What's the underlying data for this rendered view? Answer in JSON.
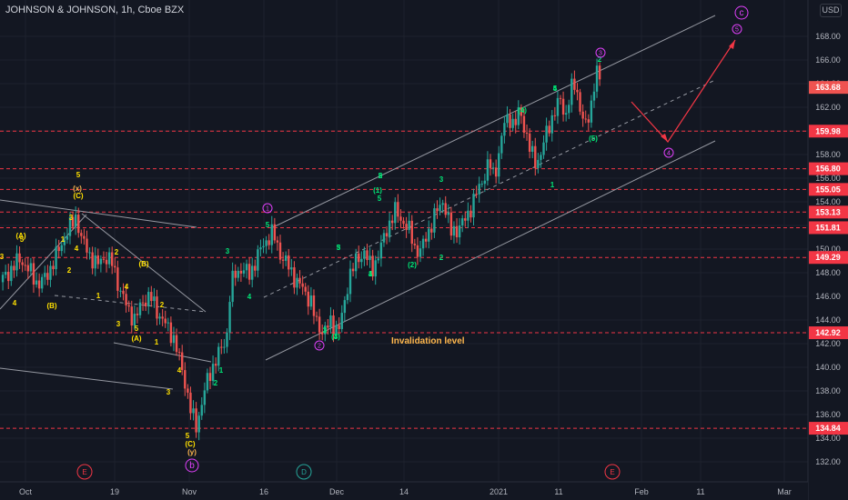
{
  "header": {
    "title": "JOHNSON & JOHNSON, 1h, Cboe BZX",
    "currency": "USD"
  },
  "chart_data": {
    "type": "candlestick",
    "title": "JOHNSON & JOHNSON, 1h, Cboe BZX",
    "ylim": [
      131,
      171
    ],
    "y_ticks": [
      "132.00",
      "134.00",
      "136.00",
      "138.00",
      "140.00",
      "142.00",
      "144.00",
      "146.00",
      "148.00",
      "150.00",
      "152.00",
      "154.00",
      "156.00",
      "158.00",
      "160.00",
      "162.00",
      "164.00",
      "166.00",
      "168.00"
    ],
    "x_ticks": [
      "Oct",
      "19",
      "Nov",
      "16",
      "Dec",
      "14",
      "2021",
      "11",
      "Feb",
      "11",
      "Mar"
    ],
    "price_path": [
      {
        "t": 0.0,
        "p": 147.2
      },
      {
        "t": 0.02,
        "p": 148.2
      },
      {
        "t": 0.04,
        "p": 149.2
      },
      {
        "t": 0.06,
        "p": 148.0
      },
      {
        "t": 0.075,
        "p": 147.0
      },
      {
        "t": 0.09,
        "p": 147.6
      },
      {
        "t": 0.11,
        "p": 149.4
      },
      {
        "t": 0.13,
        "p": 151.3
      },
      {
        "t": 0.15,
        "p": 152.8
      },
      {
        "t": 0.16,
        "p": 150.8
      },
      {
        "t": 0.175,
        "p": 149.6
      },
      {
        "t": 0.19,
        "p": 148.6
      },
      {
        "t": 0.205,
        "p": 149.4
      },
      {
        "t": 0.22,
        "p": 148.8
      },
      {
        "t": 0.235,
        "p": 146.6
      },
      {
        "t": 0.25,
        "p": 145.0
      },
      {
        "t": 0.265,
        "p": 144.0
      },
      {
        "t": 0.28,
        "p": 145.6
      },
      {
        "t": 0.295,
        "p": 146.0
      },
      {
        "t": 0.31,
        "p": 144.6
      },
      {
        "t": 0.325,
        "p": 143.6
      },
      {
        "t": 0.34,
        "p": 142.6
      },
      {
        "t": 0.355,
        "p": 140.2
      },
      {
        "t": 0.365,
        "p": 138.4
      },
      {
        "t": 0.375,
        "p": 136.2
      },
      {
        "t": 0.385,
        "p": 135.0
      },
      {
        "t": 0.395,
        "p": 136.8
      },
      {
        "t": 0.405,
        "p": 138.6
      },
      {
        "t": 0.415,
        "p": 139.8
      },
      {
        "t": 0.425,
        "p": 140.8
      },
      {
        "t": 0.435,
        "p": 141.6
      },
      {
        "t": 0.445,
        "p": 142.6
      },
      {
        "t": 0.452,
        "p": 146.6
      },
      {
        "t": 0.46,
        "p": 147.8
      },
      {
        "t": 0.475,
        "p": 148.4
      },
      {
        "t": 0.49,
        "p": 147.8
      },
      {
        "t": 0.505,
        "p": 149.4
      },
      {
        "t": 0.52,
        "p": 150.6
      },
      {
        "t": 0.535,
        "p": 151.4
      },
      {
        "t": 0.55,
        "p": 149.6
      },
      {
        "t": 0.565,
        "p": 148.6
      },
      {
        "t": 0.58,
        "p": 147.4
      },
      {
        "t": 0.595,
        "p": 146.6
      },
      {
        "t": 0.61,
        "p": 145.6
      },
      {
        "t": 0.62,
        "p": 143.8
      },
      {
        "t": 0.635,
        "p": 143.0
      },
      {
        "t": 0.65,
        "p": 143.8
      },
      {
        "t": 0.665,
        "p": 143.2
      },
      {
        "t": 0.675,
        "p": 145.0
      },
      {
        "t": 0.685,
        "p": 147.8
      },
      {
        "t": 0.7,
        "p": 149.0
      },
      {
        "t": 0.715,
        "p": 149.8
      },
      {
        "t": 0.73,
        "p": 148.2
      },
      {
        "t": 0.745,
        "p": 149.8
      },
      {
        "t": 0.76,
        "p": 151.8
      },
      {
        "t": 0.775,
        "p": 153.2
      },
      {
        "t": 0.79,
        "p": 152.4
      },
      {
        "t": 0.805,
        "p": 151.4
      },
      {
        "t": 0.815,
        "p": 150.0
      },
      {
        "t": 0.825,
        "p": 149.8
      },
      {
        "t": 0.84,
        "p": 151.4
      },
      {
        "t": 0.855,
        "p": 153.0
      },
      {
        "t": 0.87,
        "p": 154.2
      },
      {
        "t": 0.885,
        "p": 151.4
      },
      {
        "t": 0.9,
        "p": 151.8
      },
      {
        "t": 0.915,
        "p": 152.6
      },
      {
        "t": 0.93,
        "p": 154.2
      },
      {
        "t": 0.945,
        "p": 155.6
      },
      {
        "t": 0.96,
        "p": 157.4
      },
      {
        "t": 0.97,
        "p": 156.0
      },
      {
        "t": 0.98,
        "p": 158.4
      },
      {
        "t": 0.99,
        "p": 160.6
      },
      {
        "t": 1.0,
        "p": 161.2
      },
      {
        "t": 1.01,
        "p": 160.4
      },
      {
        "t": 1.02,
        "p": 161.8
      },
      {
        "t": 1.03,
        "p": 160.2
      },
      {
        "t": 1.04,
        "p": 158.4
      },
      {
        "t": 1.05,
        "p": 157.4
      },
      {
        "t": 1.06,
        "p": 157.8
      },
      {
        "t": 1.075,
        "p": 160.2
      },
      {
        "t": 1.09,
        "p": 161.8
      },
      {
        "t": 1.1,
        "p": 162.6
      },
      {
        "t": 1.11,
        "p": 161.2
      },
      {
        "t": 1.12,
        "p": 163.4
      },
      {
        "t": 1.13,
        "p": 164.0
      },
      {
        "t": 1.14,
        "p": 161.6
      },
      {
        "t": 1.15,
        "p": 160.2
      },
      {
        "t": 1.16,
        "p": 162.2
      },
      {
        "t": 1.17,
        "p": 165.2
      },
      {
        "t": 1.18,
        "p": 163.7
      }
    ],
    "horizontal_levels": [
      {
        "value": 159.98,
        "label": "159.98"
      },
      {
        "value": 156.8,
        "label": "156.80"
      },
      {
        "value": 155.05,
        "label": "155.05"
      },
      {
        "value": 153.13,
        "label": "153.13"
      },
      {
        "value": 151.81,
        "label": "151.81"
      },
      {
        "value": 149.29,
        "label": "149.29"
      },
      {
        "value": 142.92,
        "label": "142.92"
      },
      {
        "value": 134.84,
        "label": "134.84"
      }
    ],
    "last_price": {
      "value": 163.68,
      "label": "163.68"
    },
    "wave_labels_yellow": [
      "(x)",
      "(C)",
      "5",
      "3",
      "4",
      "1",
      "2",
      "(A)",
      "5",
      "3",
      "4",
      "(B)",
      "1",
      "2",
      "4",
      "(B)",
      "2",
      "3",
      "5",
      "(A)",
      "1",
      "3",
      "4",
      "5",
      "(C)",
      "(y)"
    ],
    "wave_labels_green": [
      "3",
      "4",
      "5",
      "2",
      "1",
      "2",
      "3",
      "4",
      "5",
      "(1)",
      "5",
      "(2)",
      "2",
      "3",
      "(3)",
      "(4)",
      "4",
      "(5)",
      "1",
      "2",
      "3",
      "4",
      "5",
      "1",
      "2",
      "3",
      "4",
      "5"
    ],
    "wave_labels_magenta": [
      "1",
      "2",
      "3",
      "4",
      "5",
      "c",
      "b"
    ],
    "annotations": [
      "Invalidation level"
    ],
    "bottom_markers": [
      {
        "label": "E",
        "color": "#f23645"
      },
      {
        "label": "D",
        "color": "#26a69a"
      },
      {
        "label": "E",
        "color": "#f23645"
      }
    ],
    "colors": {
      "background": "#131722",
      "up": "#26a69a",
      "down": "#ef5350",
      "level": "#f23645",
      "yellow": "#ffe000",
      "green": "#00e676",
      "magenta": "#e040fb",
      "channel": "#9598a1",
      "annotation": "#ffb74d"
    }
  }
}
